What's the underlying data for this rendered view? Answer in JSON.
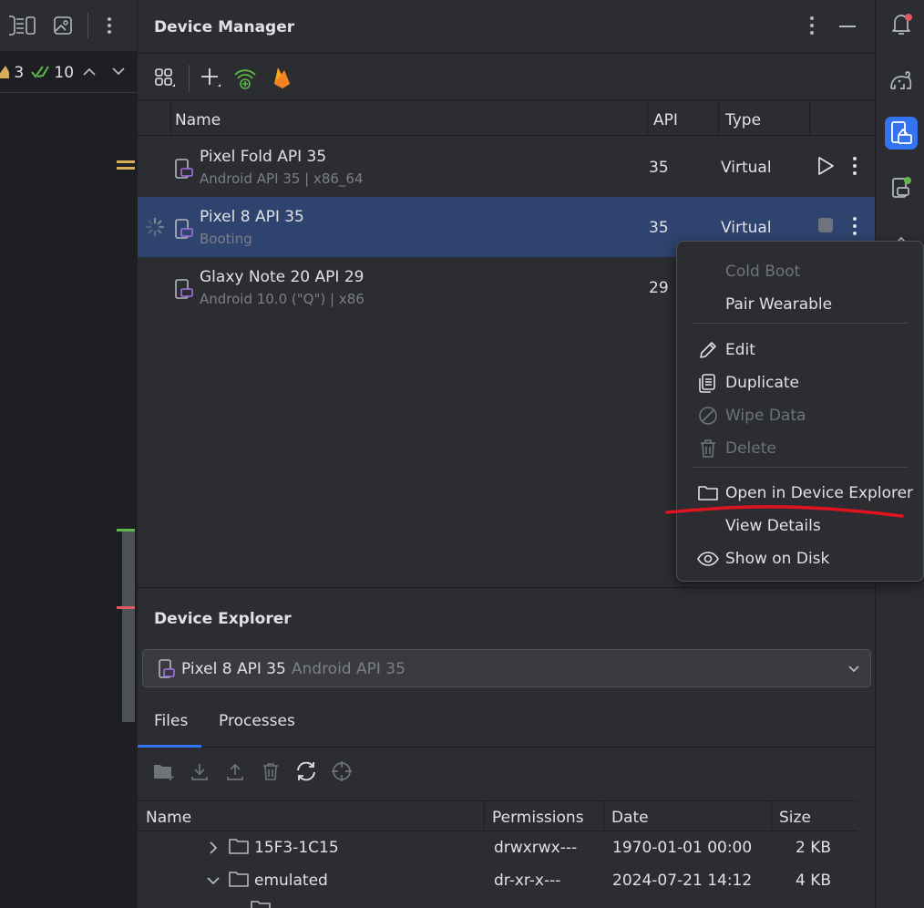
{
  "editor": {
    "warning_count": "3",
    "check_count": "10"
  },
  "device_manager": {
    "title": "Device Manager",
    "columns": {
      "name": "Name",
      "api": "API",
      "type": "Type"
    },
    "devices": [
      {
        "name": "Pixel Fold API 35",
        "subtitle": "Android API 35 | x86_64",
        "api": "35",
        "type": "Virtual",
        "state": "stopped"
      },
      {
        "name": "Pixel 8 API 35",
        "subtitle": "Booting",
        "api": "35",
        "type": "Virtual",
        "state": "booting"
      },
      {
        "name": "Glaxy Note 20 API 29",
        "subtitle": "Android 10.0 (\"Q\") | x86",
        "api": "29",
        "type": "",
        "state": "stopped"
      }
    ]
  },
  "context_menu": {
    "items": [
      {
        "label": "Cold Boot",
        "disabled": true
      },
      {
        "label": "Pair Wearable",
        "disabled": false
      },
      {
        "label": "Edit",
        "disabled": false
      },
      {
        "label": "Duplicate",
        "disabled": false
      },
      {
        "label": "Wipe Data",
        "disabled": true
      },
      {
        "label": "Delete",
        "disabled": true
      },
      {
        "label": "Open in Device Explorer",
        "disabled": false
      },
      {
        "label": "View Details",
        "disabled": false
      },
      {
        "label": "Show on Disk",
        "disabled": false
      }
    ]
  },
  "device_explorer": {
    "title": "Device Explorer",
    "selected_device": {
      "name": "Pixel 8 API 35",
      "subtitle": "Android API 35"
    },
    "tabs": [
      "Files",
      "Processes"
    ],
    "active_tab": "Files",
    "columns": {
      "name": "Name",
      "permissions": "Permissions",
      "date": "Date",
      "size": "Size"
    },
    "files": [
      {
        "name": "15F3-1C15",
        "permissions": "drwxrwx---",
        "date": "1970-01-01 00:00",
        "size": "2 KB",
        "expanded": false
      },
      {
        "name": "emulated",
        "permissions": "dr-xr-x---",
        "date": "2024-07-21 14:12",
        "size": "4 KB",
        "expanded": true
      }
    ]
  },
  "colors": {
    "accent": "#3574f0",
    "selection": "#2e436e",
    "annotation": "#e0141e"
  }
}
